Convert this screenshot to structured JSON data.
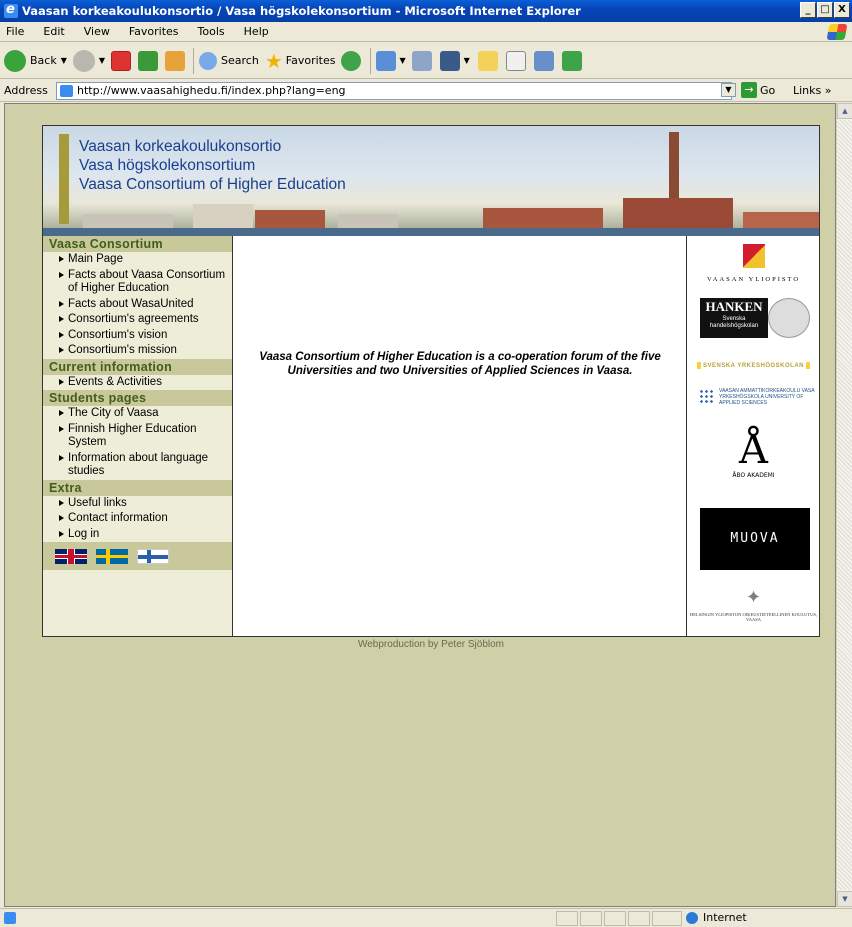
{
  "window": {
    "title": "Vaasan korkeakoulukonsortio / Vasa högskolekonsortium - Microsoft Internet Explorer",
    "minimize": "_",
    "maximize": "□",
    "close": "X"
  },
  "menu": [
    "File",
    "Edit",
    "View",
    "Favorites",
    "Tools",
    "Help"
  ],
  "toolbar": {
    "back_label": "Back",
    "search_label": "Search",
    "favorites_label": "Favorites"
  },
  "address": {
    "label": "Address",
    "url": "http://www.vaasahighedu.fi/index.php?lang=eng",
    "go_label": "Go",
    "links_label": "Links »"
  },
  "banner": {
    "line1": "Vaasan korkeakoulukonsortio",
    "line2": "Vasa högskolekonsortium",
    "line3": "Vaasa Consortium of Higher Education"
  },
  "nav": {
    "sec1": "Vaasa Consortium",
    "sec1_items": [
      "Main Page",
      "Facts about Vaasa Consortium of Higher Education",
      "Facts about WasaUnited",
      "Consortium's agreements",
      "Consortium's vision",
      "Consortium's mission"
    ],
    "sec2": "Current information",
    "sec2_items": [
      "Events & Activities"
    ],
    "sec3": "Students pages",
    "sec3_items": [
      "The City of Vaasa",
      "Finnish Higher Education System",
      "Information about language studies"
    ],
    "sec4": "Extra",
    "sec4_items": [
      "Useful links",
      "Contact information",
      "Log in"
    ]
  },
  "content": {
    "intro": "Vaasa Consortium of Higher Education is a co-operation forum of the five Universities and two Universities of Applied Sciences in Vaasa."
  },
  "logos": {
    "vy": "VAASAN YLIOPISTO",
    "hanken": "HANKEN",
    "hanken_sub": "Svenska handelshögskolan",
    "sy": "SVENSKA YRKESHÖGSKOLAN",
    "vamk": "VAASAN AMMATTIKORKEAKOULU VASA YRKESHÖGSKOLA UNIVERSITY OF APPLIED SCIENCES",
    "abo": "ÅBO AKADEMI",
    "abo_glyph": "Å",
    "muova": "MUOVA",
    "hy": "HELSINGIN YLIOPISTON OIKEUSTIETEELLINEN KOULUTUS, VAASA",
    "hy_glyph": "✦"
  },
  "footer": "Webproduction by Peter Sjöblom",
  "status": {
    "zone": "Internet"
  }
}
